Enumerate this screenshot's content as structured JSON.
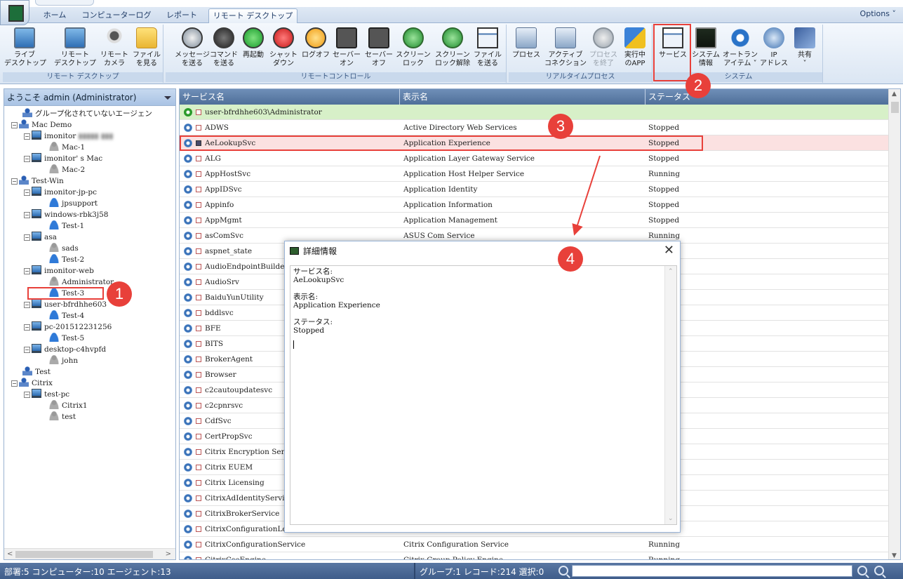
{
  "ribbon_tabs": [
    {
      "label": "ホーム"
    },
    {
      "label": "コンピューターログ"
    },
    {
      "label": "レポート"
    },
    {
      "label": "リモート デスクトップ",
      "active": true
    }
  ],
  "options_label": "Options ˅",
  "groups": {
    "remote_desktop": "リモート デスクトップ",
    "remote_control": "リモートコントロール",
    "realtime_process": "リアルタイムプロセス",
    "system": "システム"
  },
  "buttons": {
    "live_desktop": "ライブ\nデスクトップ",
    "remote_desktop": "リモート\nデスクトップ",
    "remote_camera": "リモート\nカメラ",
    "view_files": "ファイル\nを見る",
    "send_message": "メッセージ\nを送る",
    "send_command": "コマンド\nを送る",
    "restart": "再起動",
    "shutdown": "シャット\nダウン",
    "logoff": "ログオフ",
    "server_on": "セーバー\nオン",
    "server_off": "セーバー\nオフ",
    "screen_lock": "スクリーン\nロック",
    "screen_unlock": "スクリーン\nロック解除",
    "send_file": "ファイル\nを送る",
    "process": "プロセス",
    "active_connections": "アクティブ\nコネクション",
    "end_process": "プロセス\nを終了",
    "running_app": "実行中\nのAPP",
    "services": "サービス",
    "system_info": "システム\n情報",
    "autorun_items": "オートラン\nアイテム ˅",
    "ip_address": "IP\nアドレス",
    "share": "共有\n˅"
  },
  "tree": {
    "header": "ようこそ admin (Administrator)",
    "nodes": [
      {
        "label": "グループ化されていないエージェン"
      },
      {
        "label": "Mac Demo"
      },
      {
        "label": "imonitor"
      },
      {
        "label": "Mac-1"
      },
      {
        "label": "imonitor' s Mac"
      },
      {
        "label": "Mac-2"
      },
      {
        "label": "Test-Win"
      },
      {
        "label": "imonitor-jp-pc"
      },
      {
        "label": "jpsupport"
      },
      {
        "label": "windows-rbk3j58"
      },
      {
        "label": "Test-1"
      },
      {
        "label": "asa"
      },
      {
        "label": "sads"
      },
      {
        "label": "Test-2"
      },
      {
        "label": "imonitor-web"
      },
      {
        "label": "Administrator"
      },
      {
        "label": "Test-3"
      },
      {
        "label": "user-bfrdhhe603"
      },
      {
        "label": "Test-4"
      },
      {
        "label": "pc-201512231256"
      },
      {
        "label": "Test-5"
      },
      {
        "label": "desktop-c4hvpfd"
      },
      {
        "label": "john"
      },
      {
        "label": "Test"
      },
      {
        "label": "Citrix"
      },
      {
        "label": "test-pc"
      },
      {
        "label": "Citrix1"
      },
      {
        "label": "test"
      }
    ]
  },
  "list": {
    "columns": [
      "サービス名",
      "表示名",
      "ステータス"
    ],
    "group_row": "user-bfrdhhe603\\Administrator",
    "rows": [
      {
        "name": "ADWS",
        "display": "Active Directory Web Services",
        "status": "Stopped"
      },
      {
        "name": "AeLookupSvc",
        "display": "Application Experience",
        "status": "Stopped"
      },
      {
        "name": "ALG",
        "display": "Application Layer Gateway Service",
        "status": "Stopped"
      },
      {
        "name": "AppHostSvc",
        "display": "Application Host Helper Service",
        "status": "Running"
      },
      {
        "name": "AppIDSvc",
        "display": "Application Identity",
        "status": "Stopped"
      },
      {
        "name": "Appinfo",
        "display": "Application Information",
        "status": "Stopped"
      },
      {
        "name": "AppMgmt",
        "display": "Application Management",
        "status": "Stopped"
      },
      {
        "name": "asComSvc",
        "display": "ASUS Com Service",
        "status": "Running"
      },
      {
        "name": "aspnet_state",
        "display": "",
        "status": ""
      },
      {
        "name": "AudioEndpointBuilder",
        "display": "",
        "status": ""
      },
      {
        "name": "AudioSrv",
        "display": "",
        "status": ""
      },
      {
        "name": "BaiduYunUtility",
        "display": "",
        "status": ""
      },
      {
        "name": "bddlsvc",
        "display": "",
        "status": ""
      },
      {
        "name": "BFE",
        "display": "",
        "status": ""
      },
      {
        "name": "BITS",
        "display": "",
        "status": ""
      },
      {
        "name": "BrokerAgent",
        "display": "",
        "status": ""
      },
      {
        "name": "Browser",
        "display": "",
        "status": ""
      },
      {
        "name": "c2cautoupdatesvc",
        "display": "",
        "status": ""
      },
      {
        "name": "c2cpnrsvc",
        "display": "",
        "status": ""
      },
      {
        "name": "CdfSvc",
        "display": "",
        "status": ""
      },
      {
        "name": "CertPropSvc",
        "display": "",
        "status": ""
      },
      {
        "name": "Citrix Encryption Service",
        "display": "",
        "status": ""
      },
      {
        "name": "Citrix EUEM",
        "display": "",
        "status": ""
      },
      {
        "name": "Citrix Licensing",
        "display": "",
        "status": ""
      },
      {
        "name": "CitrixAdIdentityService",
        "display": "",
        "status": ""
      },
      {
        "name": "CitrixBrokerService",
        "display": "",
        "status": ""
      },
      {
        "name": "CitrixConfigurationLogging",
        "display": "",
        "status": ""
      },
      {
        "name": "CitrixConfigurationService",
        "display": "Citrix Configuration Service",
        "status": "Running"
      },
      {
        "name": "CitrixCseEngine",
        "display": "Citrix Group Policy Engine",
        "status": "Running"
      }
    ]
  },
  "dialog": {
    "title": "詳細情報",
    "close": "✕",
    "service_name_label": "サービス名:",
    "service_name_value": "AeLookupSvc",
    "display_name_label": "表示名:",
    "display_name_value": "Application Experience",
    "status_label": "ステータス:",
    "status_value": "Stopped"
  },
  "status": {
    "left": "部署:5 コンピューター:10 エージェント:13",
    "right": "グループ:1 レコード:214 選択:0"
  },
  "annotations": [
    "1",
    "2",
    "3",
    "4"
  ],
  "colors": {
    "accent": "#e8403a",
    "header_blue": "#4f6f99",
    "group_row_green": "#d7f0c8",
    "selected_row": "#fbe1e1"
  }
}
